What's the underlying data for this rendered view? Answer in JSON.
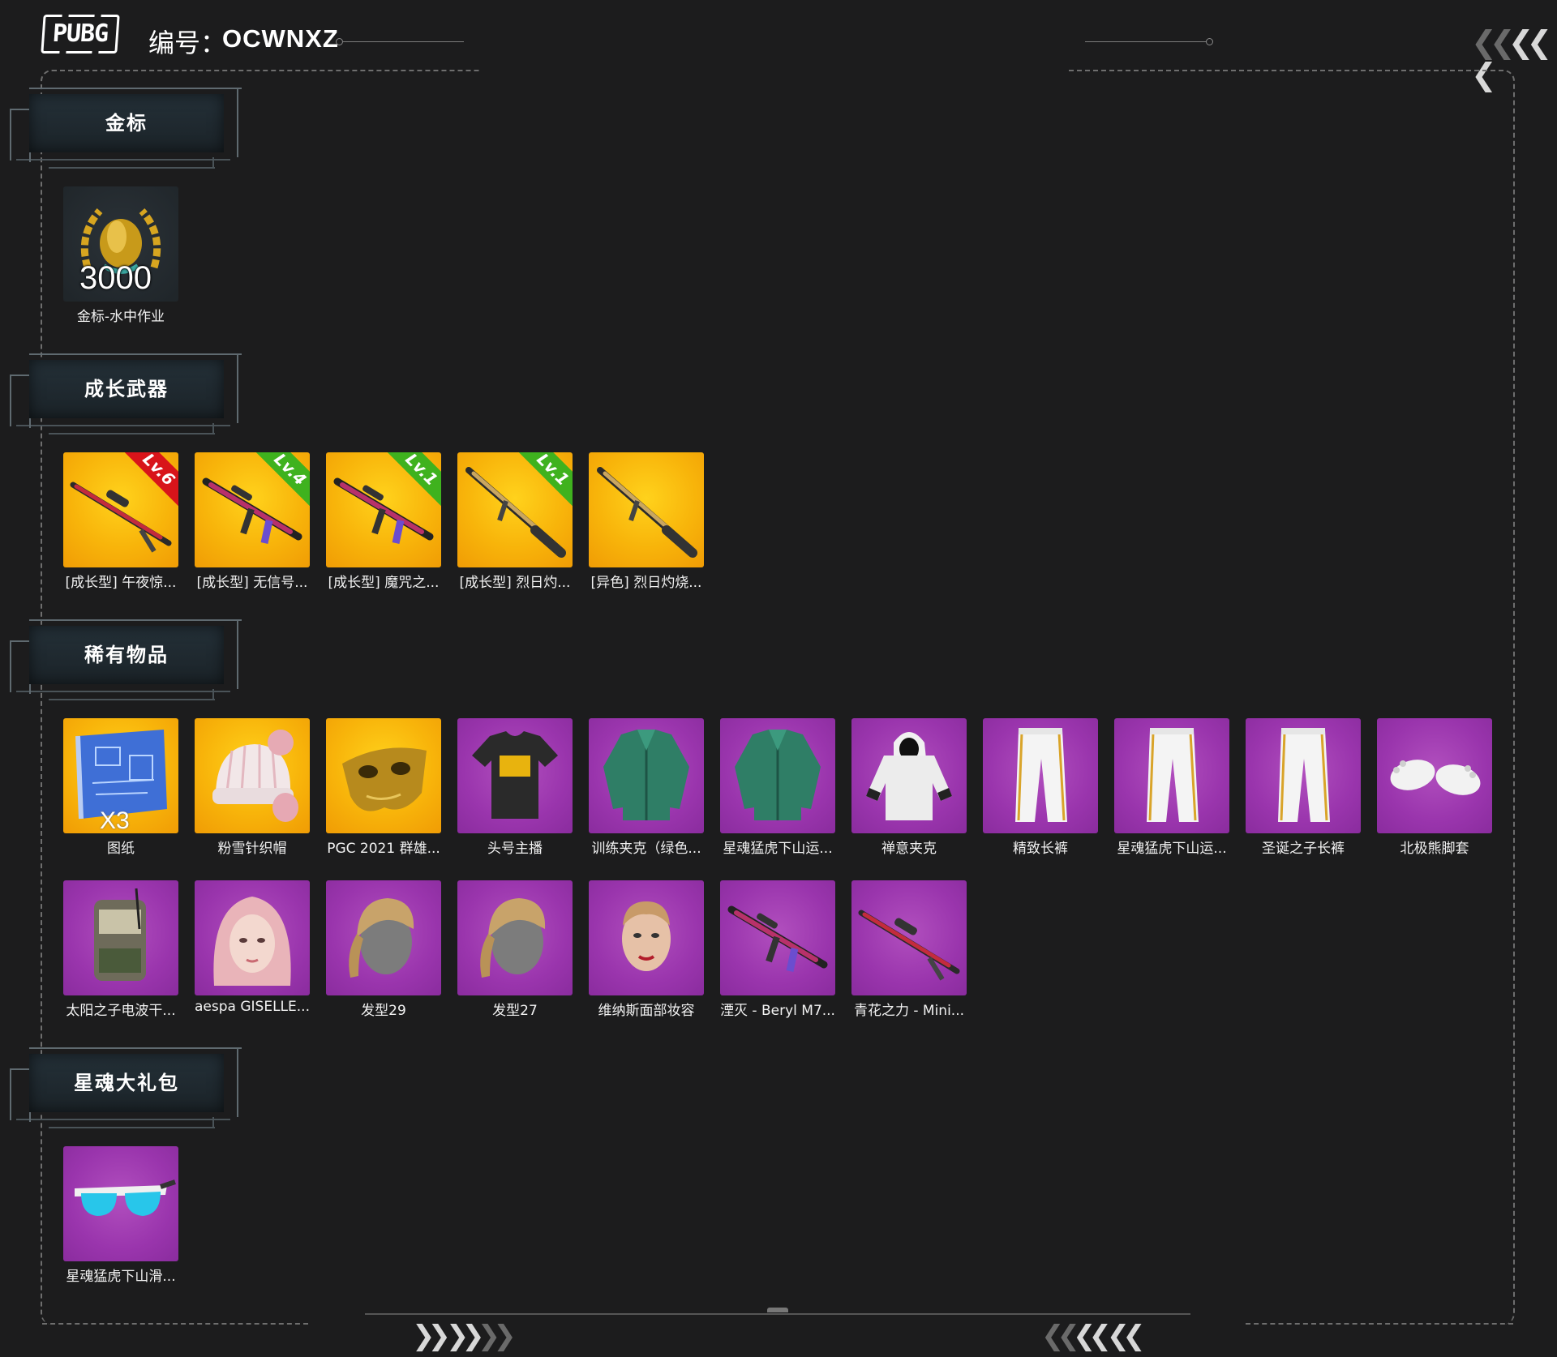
{
  "header": {
    "logo_text": "PUBG",
    "serial_label": "编号：",
    "serial_value": "OCWNXZ"
  },
  "sections": [
    {
      "title": "金标",
      "items": [
        {
          "label": "金标-水中作业",
          "bg": "dark",
          "icon": "gold-seal-laurel-icon",
          "overlay": "3000"
        }
      ]
    },
    {
      "title": "成长武器",
      "items": [
        {
          "label": "[成长型] 午夜惊...",
          "bg": "gold",
          "icon": "sniper-rifle-icon",
          "level": "Lv.6",
          "level_color": "#d8141a"
        },
        {
          "label": "[成长型] 无信号...",
          "bg": "gold",
          "icon": "assault-rifle-icon",
          "level": "Lv.4",
          "level_color": "#3fb21e"
        },
        {
          "label": "[成长型] 魔咒之...",
          "bg": "gold",
          "icon": "assault-rifle-icon",
          "level": "Lv.1",
          "level_color": "#3fb21e"
        },
        {
          "label": "[成长型] 烈日灼...",
          "bg": "gold",
          "icon": "shotgun-icon",
          "level": "Lv.1",
          "level_color": "#3fb21e"
        },
        {
          "label": "[异色] 烈日灼烧...",
          "bg": "gold",
          "icon": "shotgun-icon"
        }
      ]
    },
    {
      "title": "稀有物品",
      "items": [
        {
          "label": "图纸",
          "bg": "gold",
          "icon": "blueprint-icon",
          "overlay": "X3"
        },
        {
          "label": "粉雪针织帽",
          "bg": "gold",
          "icon": "knit-hat-icon"
        },
        {
          "label": "PGC 2021 群雄...",
          "bg": "gold",
          "icon": "mask-icon"
        },
        {
          "label": "头号主播",
          "bg": "purple",
          "icon": "tshirt-icon"
        },
        {
          "label": "训练夹克（绿色...",
          "bg": "purple",
          "icon": "jacket-icon"
        },
        {
          "label": "星魂猛虎下山运...",
          "bg": "purple",
          "icon": "jacket-icon"
        },
        {
          "label": "禅意夹克",
          "bg": "purple",
          "icon": "hoodie-icon"
        },
        {
          "label": "精致长裤",
          "bg": "purple",
          "icon": "pants-icon"
        },
        {
          "label": "星魂猛虎下山运...",
          "bg": "purple",
          "icon": "pants-icon"
        },
        {
          "label": "圣诞之子长裤",
          "bg": "purple",
          "icon": "pants-icon"
        },
        {
          "label": "北极熊脚套",
          "bg": "purple",
          "icon": "paw-slippers-icon"
        },
        {
          "label": "太阳之子电波干...",
          "bg": "purple",
          "icon": "backpack-icon"
        },
        {
          "label": "aespa GISELLE...",
          "bg": "purple",
          "icon": "female-face-icon"
        },
        {
          "label": "发型29",
          "bg": "purple",
          "icon": "hairstyle-icon"
        },
        {
          "label": "发型27",
          "bg": "purple",
          "icon": "hairstyle-icon"
        },
        {
          "label": "维纳斯面部妆容",
          "bg": "purple",
          "icon": "face-makeup-icon"
        },
        {
          "label": "湮灭 - Beryl M7...",
          "bg": "purple",
          "icon": "assault-rifle-icon"
        },
        {
          "label": "青花之力 - Mini...",
          "bg": "purple",
          "icon": "sniper-rifle-icon"
        }
      ]
    },
    {
      "title": "星魂大礼包",
      "items": [
        {
          "label": "星魂猛虎下山滑...",
          "bg": "purple",
          "icon": "sunglasses-icon"
        }
      ]
    }
  ]
}
